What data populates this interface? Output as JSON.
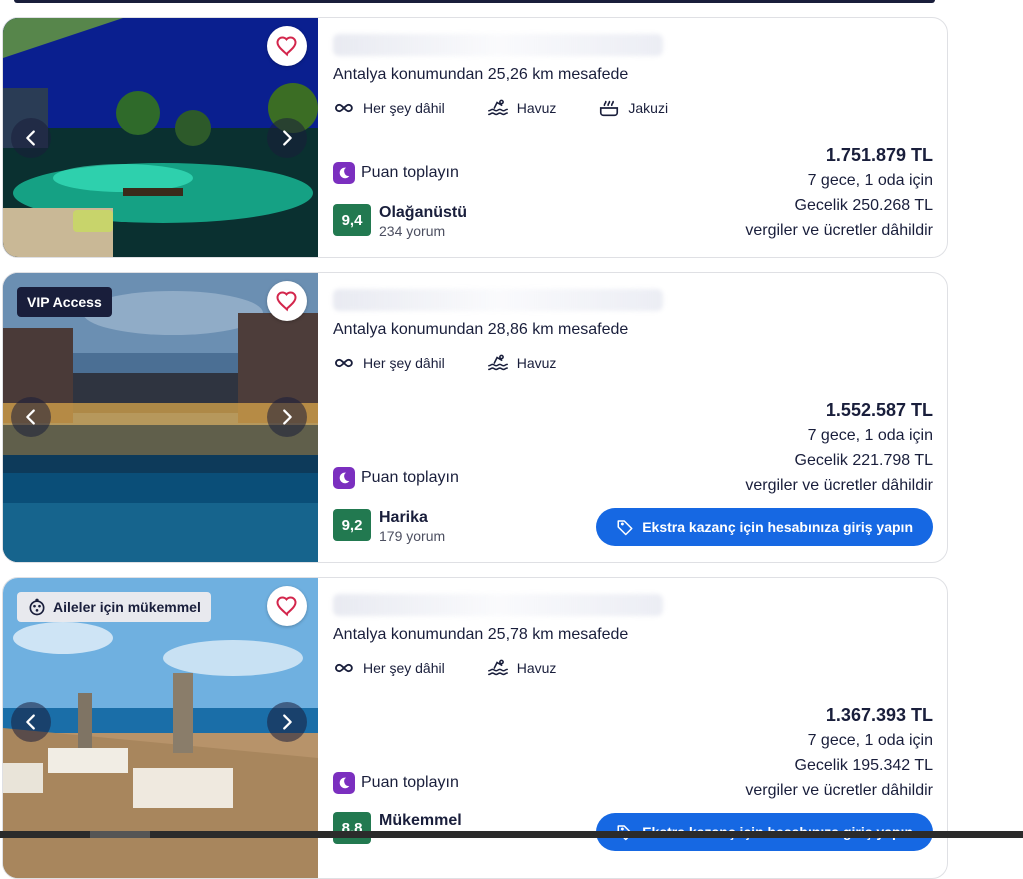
{
  "colors": {
    "brand_dark": "#191e3b",
    "accent_blue": "#1668e3",
    "rating_green": "#227950",
    "points_purple": "#7b2fbf",
    "heart_red": "#d3264c"
  },
  "cards": [
    {
      "distance": "Antalya konumundan 25,26 km mesafede",
      "amenities": [
        {
          "icon": "all-inclusive-icon",
          "label": "Her şey dâhil"
        },
        {
          "icon": "pool-icon",
          "label": "Havuz"
        },
        {
          "icon": "hot-tub-icon",
          "label": "Jakuzi"
        }
      ],
      "points_label": "Puan toplayın",
      "rating": {
        "score": "9,4",
        "label": "Olağanüstü",
        "count": "234 yorum"
      },
      "price": {
        "total": "1.751.879 TL",
        "nights": "7 gece, 1 oda için",
        "nightly": "Gecelik 250.268 TL",
        "note": "vergiler ve ücretler dâhildir"
      }
    },
    {
      "badge": "VIP Access",
      "distance": "Antalya konumundan 28,86 km mesafede",
      "amenities": [
        {
          "icon": "all-inclusive-icon",
          "label": "Her şey dâhil"
        },
        {
          "icon": "pool-icon",
          "label": "Havuz"
        }
      ],
      "points_label": "Puan toplayın",
      "rating": {
        "score": "9,2",
        "label": "Harika",
        "count": "179 yorum"
      },
      "price": {
        "total": "1.552.587 TL",
        "nights": "7 gece, 1 oda için",
        "nightly": "Gecelik 221.798 TL",
        "note": "vergiler ve ücretler dâhildir"
      },
      "cta": "Ekstra kazanç için hesabınıza giriş yapın"
    },
    {
      "badge": "Aileler için mükemmel",
      "distance": "Antalya konumundan 25,78 km mesafede",
      "amenities": [
        {
          "icon": "all-inclusive-icon",
          "label": "Her şey dâhil"
        },
        {
          "icon": "pool-icon",
          "label": "Havuz"
        }
      ],
      "points_label": "Puan toplayın",
      "rating": {
        "score": "8,8",
        "label": "Mükemmel"
      },
      "price": {
        "total": "1.367.393 TL",
        "nights": "7 gece, 1 oda için",
        "nightly": "Gecelik 195.342 TL",
        "note": "vergiler ve ücretler dâhildir"
      },
      "cta": "Ekstra kazanç için hesabınıza giriş yapın"
    }
  ]
}
